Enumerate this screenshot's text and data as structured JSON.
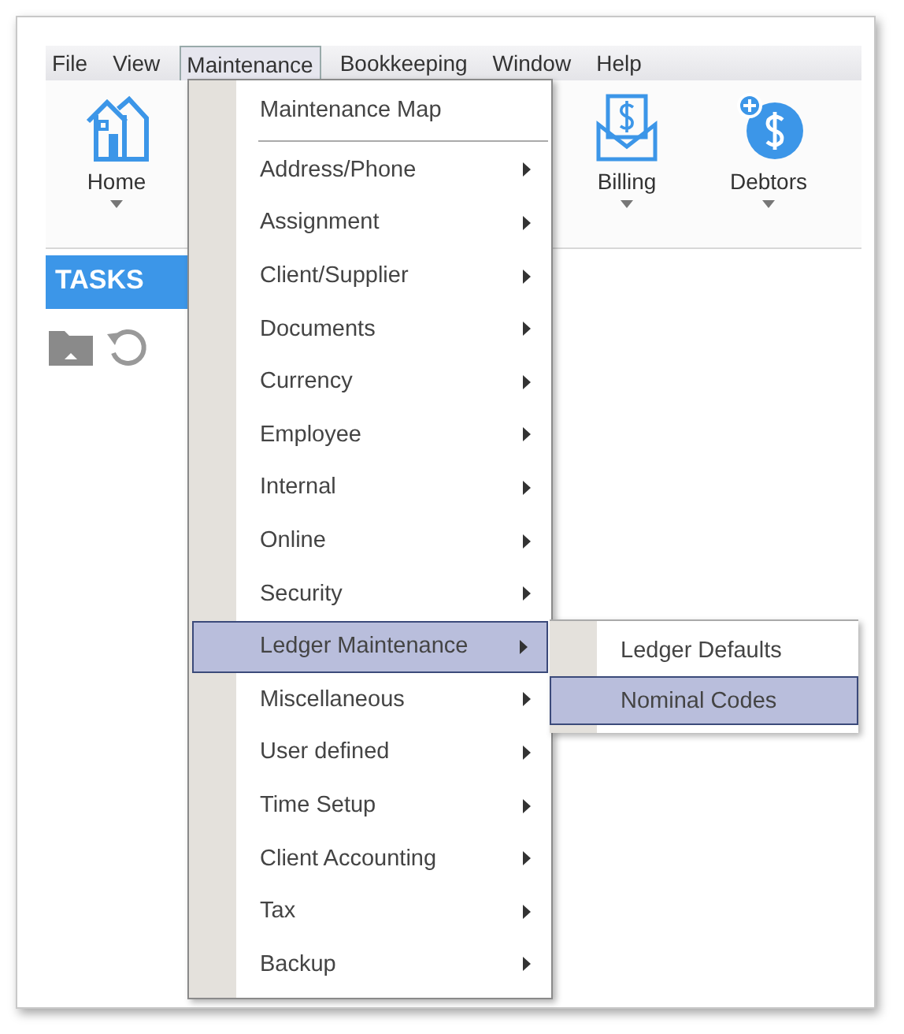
{
  "menubar": [
    {
      "label": "File",
      "selected": false
    },
    {
      "label": "View",
      "selected": false
    },
    {
      "label": "Maintenance",
      "selected": true
    },
    {
      "label": "Bookkeeping",
      "selected": false
    },
    {
      "label": "Window",
      "selected": false
    },
    {
      "label": "Help",
      "selected": false
    }
  ],
  "toolbar": [
    {
      "label": "Home",
      "kind": "home"
    },
    {
      "label": "Billing",
      "kind": "billing"
    },
    {
      "label": "Debtors",
      "kind": "debtors"
    }
  ],
  "sidebar": {
    "header": "TASKS"
  },
  "dropdown": {
    "items": [
      {
        "label": "Maintenance Map",
        "has_submenu": false,
        "selected": false,
        "separator_after": true
      },
      {
        "label": "Address/Phone",
        "has_submenu": true,
        "selected": false,
        "separator_after": false
      },
      {
        "label": "Assignment",
        "has_submenu": true,
        "selected": false,
        "separator_after": false
      },
      {
        "label": "Client/Supplier",
        "has_submenu": true,
        "selected": false,
        "separator_after": false
      },
      {
        "label": "Documents",
        "has_submenu": true,
        "selected": false,
        "separator_after": false
      },
      {
        "label": "Currency",
        "has_submenu": true,
        "selected": false,
        "separator_after": false
      },
      {
        "label": "Employee",
        "has_submenu": true,
        "selected": false,
        "separator_after": false
      },
      {
        "label": "Internal",
        "has_submenu": true,
        "selected": false,
        "separator_after": false
      },
      {
        "label": "Online",
        "has_submenu": true,
        "selected": false,
        "separator_after": false
      },
      {
        "label": "Security",
        "has_submenu": true,
        "selected": false,
        "separator_after": false
      },
      {
        "label": "Ledger Maintenance",
        "has_submenu": true,
        "selected": true,
        "separator_after": false
      },
      {
        "label": "Miscellaneous",
        "has_submenu": true,
        "selected": false,
        "separator_after": false
      },
      {
        "label": "User defined",
        "has_submenu": true,
        "selected": false,
        "separator_after": false
      },
      {
        "label": "Time Setup",
        "has_submenu": true,
        "selected": false,
        "separator_after": false
      },
      {
        "label": "Client Accounting",
        "has_submenu": true,
        "selected": false,
        "separator_after": false
      },
      {
        "label": "Tax",
        "has_submenu": true,
        "selected": false,
        "separator_after": false
      },
      {
        "label": "Backup",
        "has_submenu": true,
        "selected": false,
        "separator_after": false
      }
    ]
  },
  "submenu": {
    "items": [
      {
        "label": "Ledger Defaults",
        "selected": false
      },
      {
        "label": "Nominal Codes",
        "selected": true
      }
    ]
  }
}
